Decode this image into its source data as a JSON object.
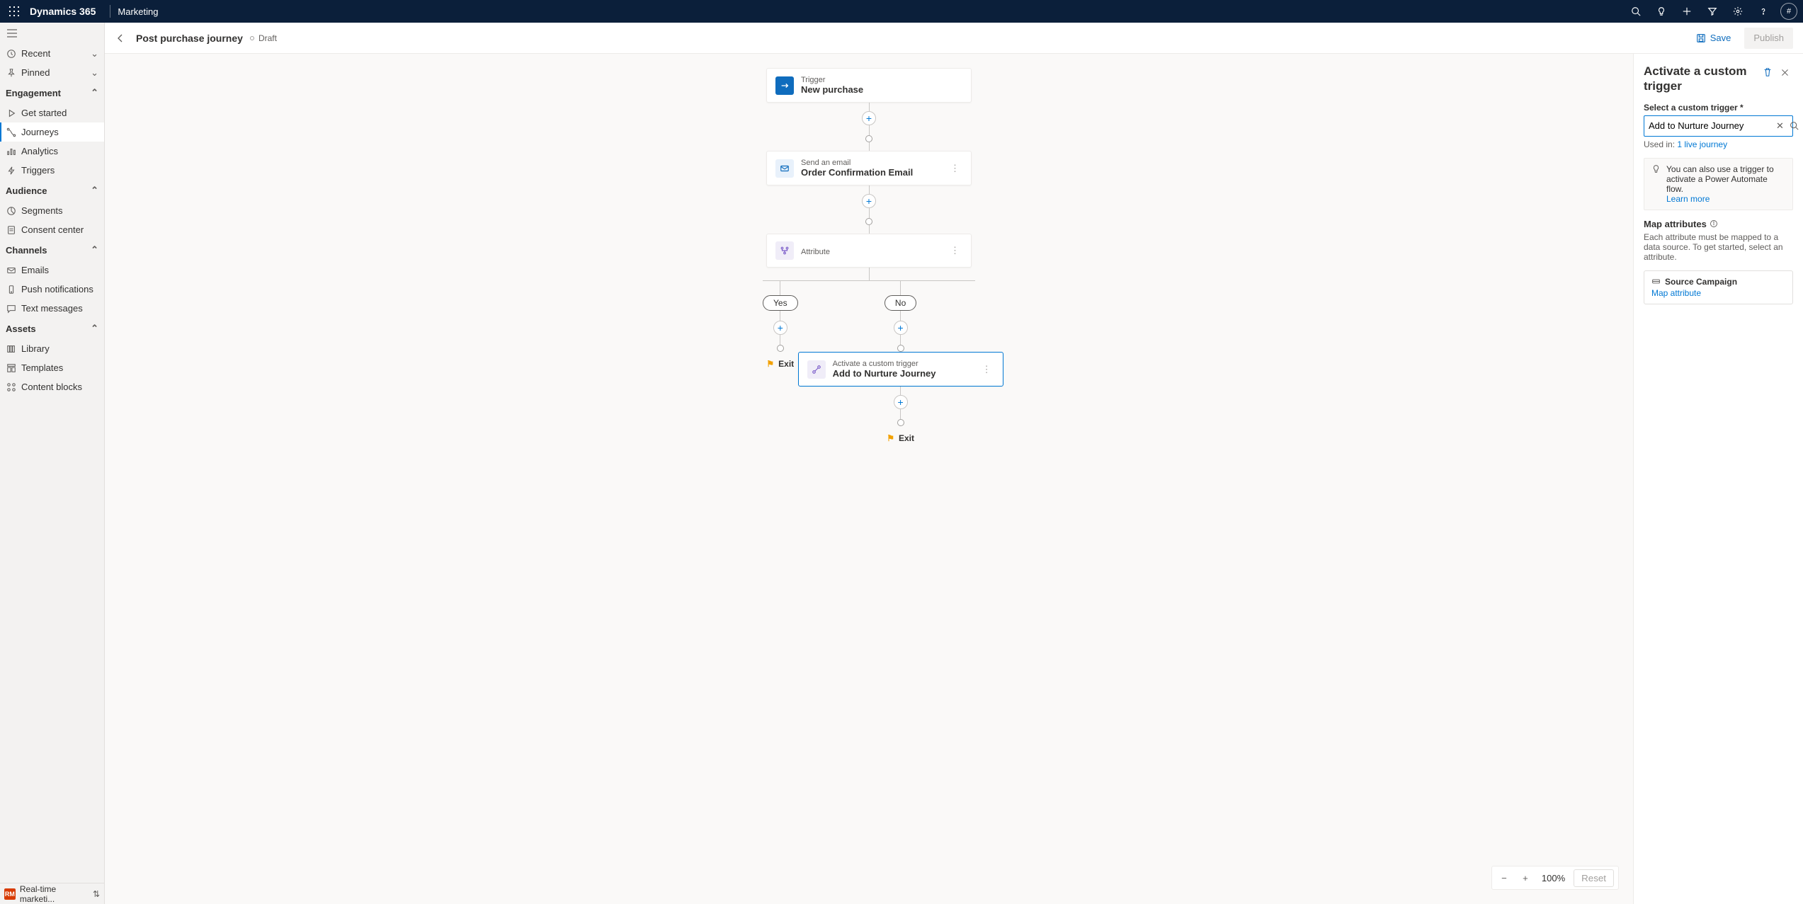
{
  "appbar": {
    "brand": "Dynamics 365",
    "product": "Marketing",
    "avatar_initial": "#"
  },
  "sidenav": {
    "recent": "Recent",
    "pinned": "Pinned",
    "sections": {
      "engagement": {
        "title": "Engagement",
        "items": {
          "get_started": "Get started",
          "journeys": "Journeys",
          "analytics": "Analytics",
          "triggers": "Triggers"
        }
      },
      "audience": {
        "title": "Audience",
        "items": {
          "segments": "Segments",
          "consent": "Consent center"
        }
      },
      "channels": {
        "title": "Channels",
        "items": {
          "emails": "Emails",
          "push": "Push notifications",
          "text": "Text messages"
        }
      },
      "assets": {
        "title": "Assets",
        "items": {
          "library": "Library",
          "templates": "Templates",
          "content_blocks": "Content blocks"
        }
      }
    },
    "bottom_badge": "RM",
    "bottom_text": "Real-time marketi..."
  },
  "cmdbar": {
    "title": "Post purchase journey",
    "status": "Draft",
    "save": "Save",
    "publish": "Publish"
  },
  "zoom": {
    "value": "100%",
    "reset": "Reset"
  },
  "flow": {
    "trigger": {
      "caption": "Trigger",
      "title": "New purchase"
    },
    "email": {
      "caption": "Send an email",
      "title": "Order Confirmation Email"
    },
    "attribute": {
      "caption": "Attribute"
    },
    "branch": {
      "yes": "Yes",
      "no": "No"
    },
    "custom_trigger": {
      "caption": "Activate a custom trigger",
      "title": "Add to Nurture Journey"
    },
    "exit": "Exit"
  },
  "rpanel": {
    "title": "Activate a custom trigger",
    "field_label": "Select a custom trigger *",
    "selected_value": "Add to Nurture Journey",
    "used_in_label": "Used in:",
    "used_in_link": "1 live journey",
    "tip_text": "You can also use a trigger to activate a Power Automate flow.",
    "tip_link": "Learn more",
    "map_head": "Map attributes",
    "map_desc": "Each attribute must be mapped to a data source. To get started, select an attribute.",
    "attr_name": "Source Campaign",
    "map_attr_link": "Map attribute"
  }
}
